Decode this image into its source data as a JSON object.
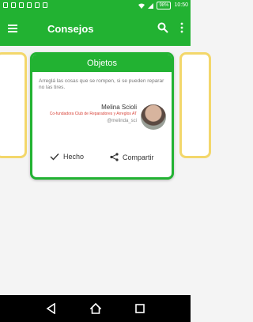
{
  "status_bar": {
    "battery": "98%",
    "time": "10:50"
  },
  "app_bar": {
    "title": "Consejos"
  },
  "card": {
    "header": "Objetos",
    "quote": "Arreglá las cosas que se rompen, si se pueden reparar no las tires.",
    "author_name": "Melina Scioli",
    "author_role": "Co-fundadora Club de Reparadores y Arreglos AT",
    "author_handle": "@melinda_sci",
    "done_label": "Hecho",
    "share_label": "Compartir"
  },
  "colors": {
    "primary_green": "#22b232",
    "side_card_border": "#f3d76b",
    "role_red": "#d8443a"
  },
  "icons": {
    "menu": "hamburger-icon",
    "search": "search-icon",
    "more": "more-vertical-icon",
    "done": "checkmark-icon",
    "share": "share-icon",
    "back": "back-triangle-icon",
    "home": "home-icon",
    "recents": "recents-square-icon"
  }
}
